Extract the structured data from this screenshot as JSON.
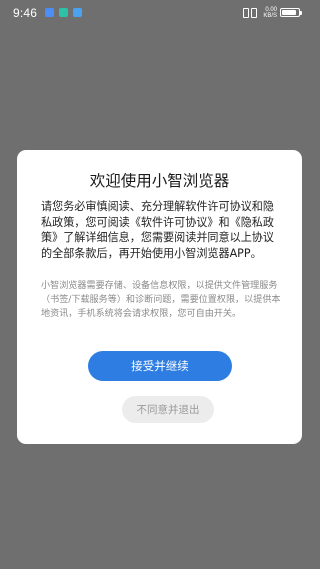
{
  "status_bar": {
    "time": "9:46",
    "network_speed": "0.00 KB/S",
    "notification_icons": [
      {
        "name": "app-notification-icon-1",
        "color": "#4c8df6"
      },
      {
        "name": "app-notification-icon-2",
        "color": "#2fc0a8"
      },
      {
        "name": "app-notification-icon-3",
        "color": "#4aa3f0"
      }
    ],
    "battery_level": 0.85
  },
  "dialog": {
    "title": "欢迎使用小智浏览器",
    "body": "请您务必审慎阅读、充分理解软件许可协议和隐私政策，您可阅读《软件许可协议》和《隐私政策》了解详细信息，您需要阅读并同意以上协议的全部条款后，再开始使用小智浏览器APP。",
    "note": "小智浏览器需要存储、设备信息权限，以提供文件管理服务（书签/下载服务等）和诊断问题，需要位置权限，以提供本地资讯，手机系统将会请求权限，您可自由开关。",
    "agree_label": "接受并继续",
    "disagree_label": "不同意并退出",
    "colors": {
      "primary": "#2d7de2",
      "overlay": "#6f6f6f"
    }
  }
}
